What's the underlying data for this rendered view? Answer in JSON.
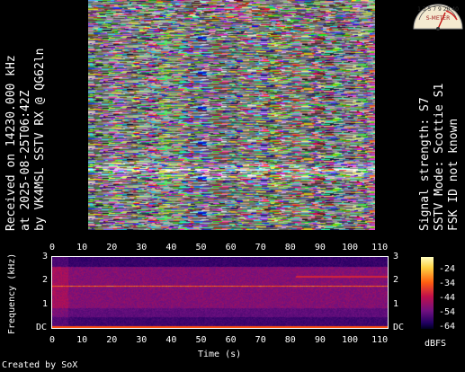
{
  "reception": {
    "line1": "Received on  14230.000 kHz",
    "line2": "at 2025-08-25T06:42Z",
    "line3": "by VK4MSL SSTV RX @ QG62ln"
  },
  "signal": {
    "line1": "Signal strength: S7",
    "line2": "SSTV Mode: Scottie S1",
    "line3": "FSK ID not known"
  },
  "s_meter": {
    "scale_label": "1 3 5 7 9 20 40",
    "label": "S-METER",
    "icon": "s-meter-gauge-icon"
  },
  "spectrogram": {
    "x_ticks": [
      "0",
      "10",
      "20",
      "30",
      "40",
      "50",
      "60",
      "70",
      "80",
      "90",
      "100",
      "110"
    ],
    "y_ticks_left": [
      "3",
      "2",
      "1",
      "DC"
    ],
    "y_ticks_right": [
      "3",
      "2",
      "1",
      "DC"
    ],
    "y_title": "Frequency (kHz)",
    "x_title": "Time (s)"
  },
  "colorbar": {
    "ticks": [
      "-24",
      "-34",
      "-44",
      "-54",
      "-64"
    ],
    "unit": "dBFS"
  },
  "footer": "Created by SoX"
}
